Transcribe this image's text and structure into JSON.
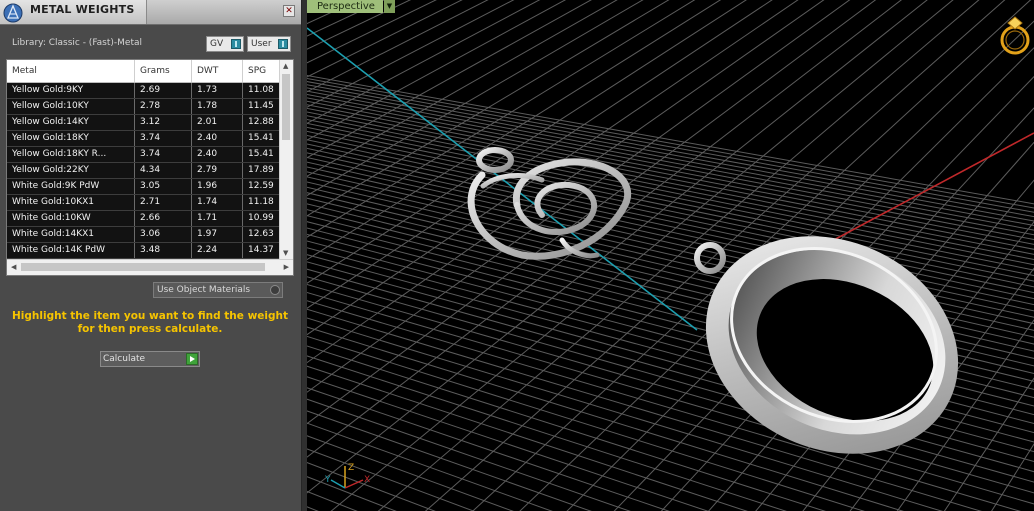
{
  "panel": {
    "title": "METAL WEIGHTS",
    "close_label": "✕",
    "library_label": "Library: Classic - (Fast)-Metal",
    "gv_label": "GV",
    "user_label": "User",
    "columns": [
      "Metal",
      "Grams",
      "DWT",
      "SPG"
    ],
    "rows": [
      [
        "Yellow Gold:9KY",
        "2.69",
        "1.73",
        "11.08"
      ],
      [
        "Yellow Gold:10KY",
        "2.78",
        "1.78",
        "11.45"
      ],
      [
        "Yellow Gold:14KY",
        "3.12",
        "2.01",
        "12.88"
      ],
      [
        "Yellow Gold:18KY",
        "3.74",
        "2.40",
        "15.41"
      ],
      [
        "Yellow Gold:18KY R...",
        "3.74",
        "2.40",
        "15.41"
      ],
      [
        "Yellow Gold:22KY",
        "4.34",
        "2.79",
        "17.89"
      ],
      [
        "White Gold:9K PdW",
        "3.05",
        "1.96",
        "12.59"
      ],
      [
        "White Gold:10KX1",
        "2.71",
        "1.74",
        "11.18"
      ],
      [
        "White Gold:10KW",
        "2.66",
        "1.71",
        "10.99"
      ],
      [
        "White Gold:14KX1",
        "3.06",
        "1.97",
        "12.63"
      ],
      [
        "White Gold:14K PdW",
        "3.48",
        "2.24",
        "14.37"
      ]
    ],
    "use_object_materials_label": "Use Object Materials",
    "instruction": "Highlight the item you want to find the weight for then press calculate.",
    "calculate_label": "Calculate"
  },
  "viewport": {
    "view_name": "Perspective",
    "axis_labels": {
      "x": "X",
      "y": "Y",
      "z": "Z"
    }
  },
  "colors": {
    "highlight_text": "#f6c400",
    "viewport_label_bg": "#9fbf7a",
    "x_axis": "#c0282a",
    "y_axis": "#1c9fb0",
    "z_axis": "#d9a21e"
  }
}
